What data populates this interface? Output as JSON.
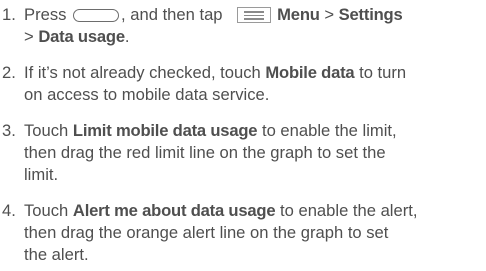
{
  "steps": [
    {
      "number": "1.",
      "press": "Press",
      "then_tap": ", and then tap",
      "menu": "Menu",
      "sep1": ">",
      "settings": "Settings",
      "sep2": ">",
      "data_usage": "Data usage",
      "end": "."
    },
    {
      "number": "2.",
      "l1_pre": "If it’s not already checked, touch",
      "mobile_data": "Mobile data",
      "l1_post": "to turn",
      "l2": "on access to mobile data service."
    },
    {
      "number": "3.",
      "l1_pre": "Touch",
      "limit": "Limit mobile data usage",
      "l1_post": "to enable the limit,",
      "l2": "then drag the red limit line on the graph to set the",
      "l3": "limit."
    },
    {
      "number": "4.",
      "l1_pre": "Touch",
      "alert": "Alert me about data usage",
      "l1_post": "to enable the alert,",
      "l2": "then drag the orange alert line on the graph to set",
      "l3": "the alert."
    }
  ],
  "icons": {
    "home_button": "home-key-icon",
    "menu_button": "menu-key-icon"
  },
  "colors": {
    "text": "#4f4f4f",
    "icon_outline": "#6d6d6d"
  }
}
